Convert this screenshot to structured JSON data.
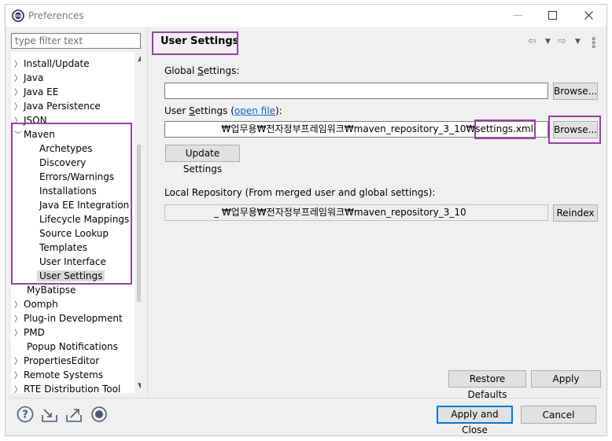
{
  "window": {
    "title": "Preferences"
  },
  "filter": {
    "placeholder": "type filter text"
  },
  "tree": {
    "items": [
      {
        "label": "Install/Update",
        "expandable": true
      },
      {
        "label": "Java",
        "expandable": true
      },
      {
        "label": "Java EE",
        "expandable": true
      },
      {
        "label": "Java Persistence",
        "expandable": true
      },
      {
        "label": "JSON",
        "expandable": true
      },
      {
        "label": "Maven",
        "expanded": true
      },
      {
        "label": "Archetypes"
      },
      {
        "label": "Discovery"
      },
      {
        "label": "Errors/Warnings"
      },
      {
        "label": "Installations"
      },
      {
        "label": "Java EE Integration"
      },
      {
        "label": "Lifecycle Mappings"
      },
      {
        "label": "Source Lookup"
      },
      {
        "label": "Templates"
      },
      {
        "label": "User Interface"
      },
      {
        "label": "User Settings",
        "selected": true
      },
      {
        "label": "MyBatipse"
      },
      {
        "label": "Oomph",
        "expandable": true
      },
      {
        "label": "Plug-in Development",
        "expandable": true
      },
      {
        "label": "PMD",
        "expandable": true
      },
      {
        "label": "Popup Notifications"
      },
      {
        "label": "PropertiesEditor",
        "expandable": true
      },
      {
        "label": "Remote Systems",
        "expandable": true
      },
      {
        "label": "RTE Distribution Tool",
        "expandable": true
      }
    ]
  },
  "page": {
    "title": "User Settings",
    "global_settings_label": "Global ",
    "global_settings_label_u": "S",
    "global_settings_label_rest": "ettings:",
    "global_settings_value": "",
    "browse_label": "Browse...",
    "user_settings_label": "User ",
    "user_settings_label_u": "S",
    "user_settings_label_rest": "ettings (",
    "open_file_link": "open file",
    "user_settings_label_end": "):",
    "user_settings_value": "₩업무용₩전자정부프레임워크₩maven_repository_3_10₩settings.xml",
    "update_settings_label": "Update Settings",
    "local_repo_label": "Local Repository (From merged user and global settings):",
    "local_repo_value": "_ ₩업무용₩전자정부프레임워크₩maven_repository_3_10",
    "reindex_label": "Reindex",
    "restore_defaults_label": "Restore Defaults",
    "apply_label": "Apply"
  },
  "footer": {
    "apply_close_label": "Apply and Close",
    "cancel_label": "Cancel",
    "icons": [
      "help-icon",
      "import-icon",
      "export-icon",
      "record-icon"
    ]
  },
  "colors": {
    "highlight": "#9b3fa8",
    "link": "#0a64c8",
    "default_button": "#0078d7"
  }
}
